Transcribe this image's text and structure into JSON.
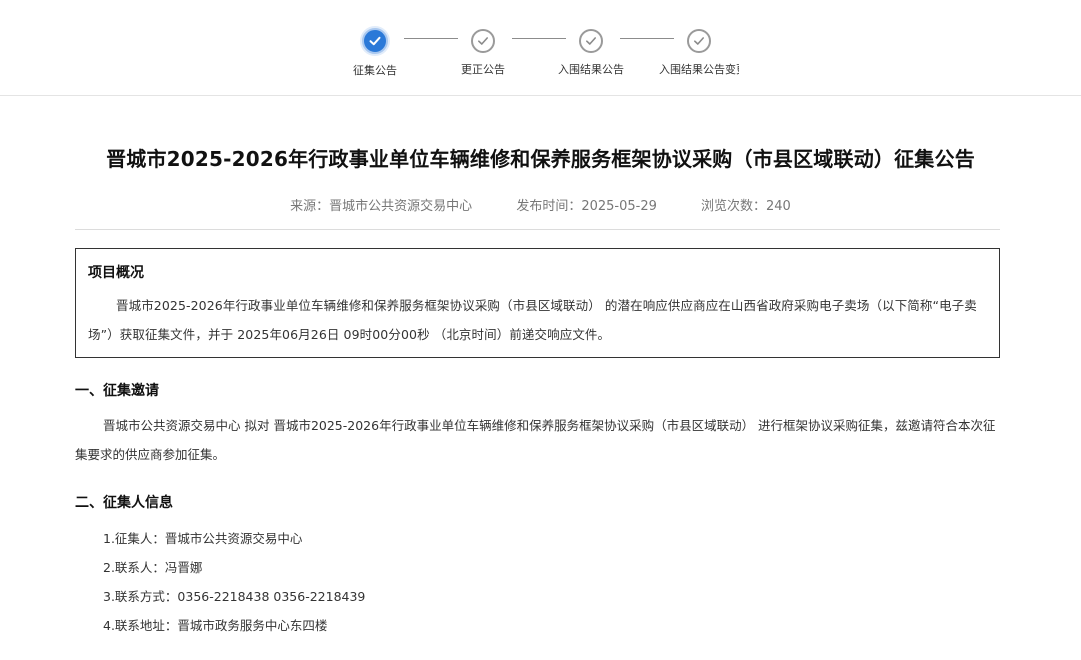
{
  "stepper": {
    "steps": [
      {
        "label": "征集公告",
        "state": "active"
      },
      {
        "label": "更正公告",
        "state": "done"
      },
      {
        "label": "入围结果公告",
        "state": "done"
      },
      {
        "label": "入围结果公告变更",
        "state": "done"
      }
    ]
  },
  "article": {
    "title": "晋城市2025-2026年行政事业单位车辆维修和保养服务框架协议采购（市县区域联动）征集公告",
    "meta": {
      "source": "来源：晋城市公共资源交易中心",
      "publish_time": "发布时间：2025-05-29",
      "views": "浏览次数：240"
    },
    "overview": {
      "heading": "项目概况",
      "text": "晋城市2025-2026年行政事业单位车辆维修和保养服务框架协议采购（市县区域联动） 的潜在响应供应商应在山西省政府采购电子卖场（以下简称“电子卖场”）获取征集文件，并于 2025年06月26日 09时00分00秒 （北京时间）前递交响应文件。"
    },
    "section1": {
      "heading": "一、征集邀请",
      "text": "晋城市公共资源交易中心 拟对 晋城市2025-2026年行政事业单位车辆维修和保养服务框架协议采购（市县区域联动） 进行框架协议采购征集，兹邀请符合本次征集要求的供应商参加征集。"
    },
    "section2": {
      "heading": "二、征集人信息",
      "items": [
        "1.征集人：晋城市公共资源交易中心",
        "2.联系人：冯晋娜",
        "3.联系方式：0356-2218438 0356-2218439",
        "4.联系地址：晋城市政务服务中心东四楼"
      ]
    }
  },
  "colors": {
    "accent": "#2b79d8",
    "inactive": "#9a9a9a",
    "title": "#111111",
    "meta": "#777777"
  },
  "icons": {
    "step_done": "check-icon"
  }
}
